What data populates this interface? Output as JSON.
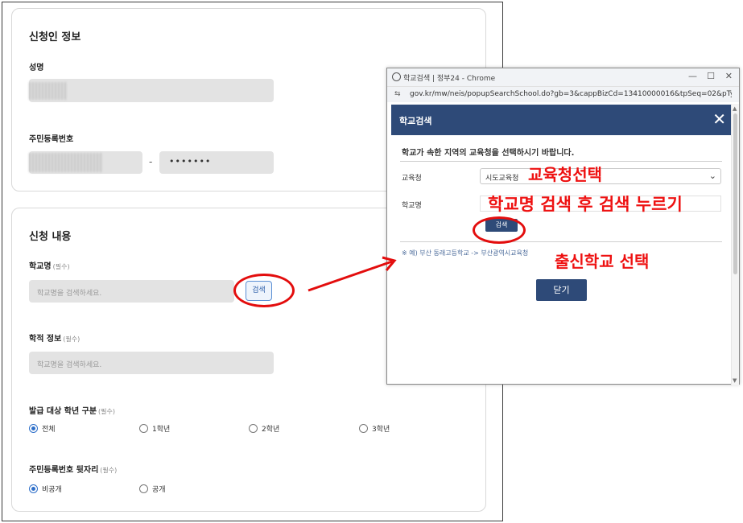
{
  "form": {
    "section1_title": "신청인 정보",
    "name_label": "성명",
    "rrn_label": "주민등록번호",
    "rrn_dash": "-",
    "rrn_masked": "•••••••",
    "section2_title": "신청 내용",
    "school_label": "학교명",
    "required_tag": "(필수)",
    "school_placeholder": "학교명을 검색하세요.",
    "search_button": "검색",
    "record_label": "학적 정보",
    "record_placeholder": "학교명을 검색하세요.",
    "grade_label": "발급 대상 학년 구분",
    "grade_options": [
      "전체",
      "1학년",
      "2학년",
      "3학년"
    ],
    "grade_selected": "전체",
    "rrn_back_label": "주민등록번호 뒷자리",
    "rrn_back_options": [
      "비공개",
      "공개"
    ],
    "rrn_back_selected": "비공개"
  },
  "popup": {
    "window_title": "학교검색 | 정부24 - Chrome",
    "url": "gov.kr/mw/neis/popupSearchSchool.do?gb=3&cappBizCd=13410000016&tpSeq=02&pType...",
    "header_title": "학교검색",
    "close_glyph": "✕",
    "instruction": "학교가 속한 지역의 교육청을 선택하시기 바랍니다.",
    "office_label": "교육청",
    "office_value": "시도교육청",
    "school_label": "학교명",
    "search_button": "검색",
    "note": "※ 예) 부산 동래고등학교 -> 부산광역시교육청",
    "close_button": "닫기"
  },
  "annotations": {
    "select_office": "교육청선택",
    "search_school": "학교명 검색 후 검색 누르기",
    "select_school": "출신학교 선택"
  },
  "colors": {
    "annotation_red": "#e30d0d",
    "popup_header": "#2e4a78",
    "radio_blue": "#2e6fc9"
  }
}
